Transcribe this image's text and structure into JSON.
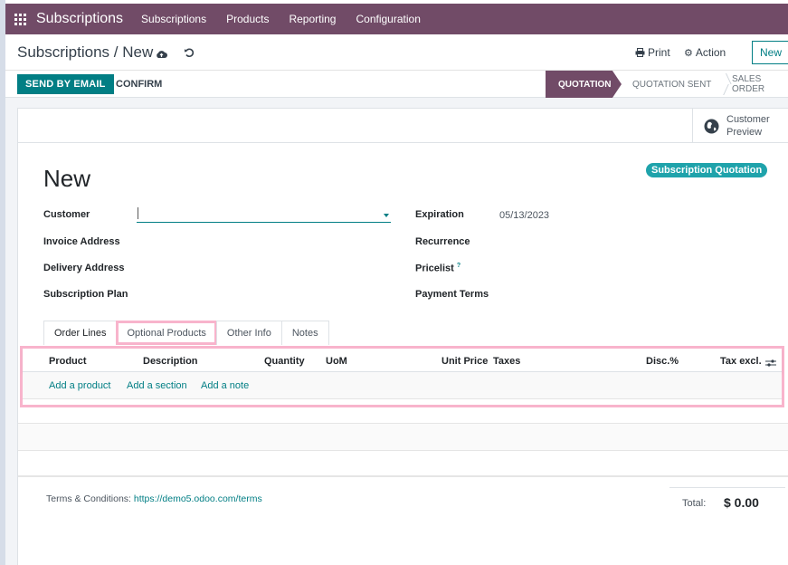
{
  "app": {
    "name": "Subscriptions",
    "menu": [
      "Subscriptions",
      "Products",
      "Reporting",
      "Configuration"
    ]
  },
  "control_panel": {
    "breadcrumb": "Subscriptions / New",
    "print_label": "Print",
    "action_label": "Action",
    "new_label": "New"
  },
  "status_bar": {
    "send_email_label": "SEND BY EMAIL",
    "confirm_label": "CONFIRM",
    "stages": [
      "QUOTATION",
      "QUOTATION SENT",
      "SALES ORDER"
    ],
    "active_stage": "QUOTATION"
  },
  "colors": {
    "brand": "#714b67",
    "accent": "#017e84",
    "badge": "#1fa3ab",
    "highlight": "#f8b4cc"
  },
  "form": {
    "preview_label_1": "Customer",
    "preview_label_2": "Preview",
    "title": "New",
    "badge": "Subscription Quotation",
    "left_fields": {
      "customer": {
        "label": "Customer",
        "value": ""
      },
      "invoice_address": {
        "label": "Invoice Address",
        "value": ""
      },
      "delivery_address": {
        "label": "Delivery Address",
        "value": ""
      },
      "subscription_plan": {
        "label": "Subscription Plan",
        "value": ""
      }
    },
    "right_fields": {
      "expiration": {
        "label": "Expiration",
        "value": "05/13/2023"
      },
      "recurrence": {
        "label": "Recurrence",
        "value": ""
      },
      "pricelist": {
        "label": "Pricelist",
        "help": "?",
        "value": ""
      },
      "payment_terms": {
        "label": "Payment Terms",
        "value": ""
      }
    },
    "tabs": [
      "Order Lines",
      "Optional Products",
      "Other Info",
      "Notes"
    ],
    "active_tab": "Order Lines",
    "columns": [
      "Product",
      "Description",
      "Quantity",
      "UoM",
      "Unit Price",
      "Taxes",
      "Disc.%",
      "Tax excl."
    ],
    "add_links": [
      "Add a product",
      "Add a section",
      "Add a note"
    ],
    "terms_label": "Terms & Conditions:",
    "terms_link": "https://demo5.odoo.com/terms",
    "total_label": "Total:",
    "total_value": "$ 0.00"
  }
}
